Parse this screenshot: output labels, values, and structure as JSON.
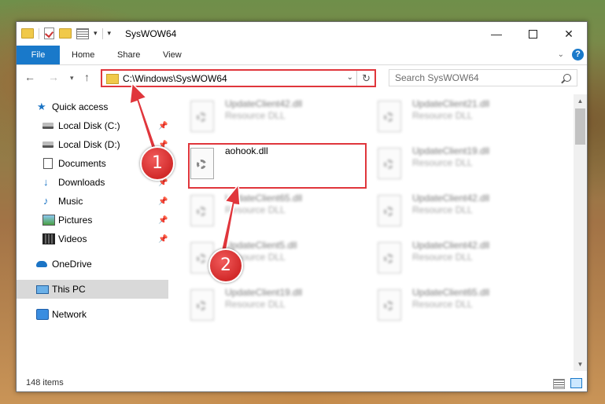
{
  "window": {
    "title": "SysWOW64",
    "minimize_glyph": "—",
    "close_glyph": "✕"
  },
  "ribbon": {
    "tabs": [
      "File",
      "Home",
      "Share",
      "View"
    ],
    "help": "?"
  },
  "navigation": {
    "address": "C:\\Windows\\SysWOW64",
    "search_placeholder": "Search SysWOW64"
  },
  "sidebar": {
    "items": [
      {
        "label": "Quick access",
        "icon": "star-icon",
        "pinned": false
      },
      {
        "label": "Local Disk (C:)",
        "icon": "disk-icon",
        "pinned": true
      },
      {
        "label": "Local Disk (D:)",
        "icon": "disk-icon",
        "pinned": true
      },
      {
        "label": "Documents",
        "icon": "documents-icon",
        "pinned": true
      },
      {
        "label": "Downloads",
        "icon": "download-icon",
        "pinned": true
      },
      {
        "label": "Music",
        "icon": "music-icon",
        "pinned": true
      },
      {
        "label": "Pictures",
        "icon": "pictures-icon",
        "pinned": true
      },
      {
        "label": "Videos",
        "icon": "videos-icon",
        "pinned": true
      },
      {
        "label": "OneDrive",
        "icon": "cloud-icon",
        "pinned": false
      },
      {
        "label": "This PC",
        "icon": "computer-icon",
        "pinned": false,
        "selected": true
      },
      {
        "label": "Network",
        "icon": "network-icon",
        "pinned": false
      }
    ]
  },
  "files": [
    {
      "name": "UpdateClient42.dll",
      "type": "Resource DLL"
    },
    {
      "name": "UpdateClient21.dll",
      "type": "Resource DLL"
    },
    {
      "name": "aohook.dll",
      "type": "",
      "highlighted": true
    },
    {
      "name": "UpdateClient19.dll",
      "type": "Resource DLL"
    },
    {
      "name": "UpdateClient65.dll",
      "type": "Resource DLL"
    },
    {
      "name": "UpdateClient42.dll",
      "type": "Resource DLL"
    },
    {
      "name": "UpdateClient5.dll",
      "type": "Resource DLL"
    },
    {
      "name": "UpdateClient42.dll",
      "type": "Resource DLL"
    },
    {
      "name": "UpdateClient19.dll",
      "type": "Resource DLL"
    },
    {
      "name": "UpdateClient65.dll",
      "type": "Resource DLL"
    }
  ],
  "status": {
    "item_count": "148 items"
  },
  "annotations": {
    "step1": "1",
    "step2": "2"
  },
  "colors": {
    "accent": "#1979ca",
    "highlight_red": "#e0363c",
    "selection": "#cce8ff"
  }
}
